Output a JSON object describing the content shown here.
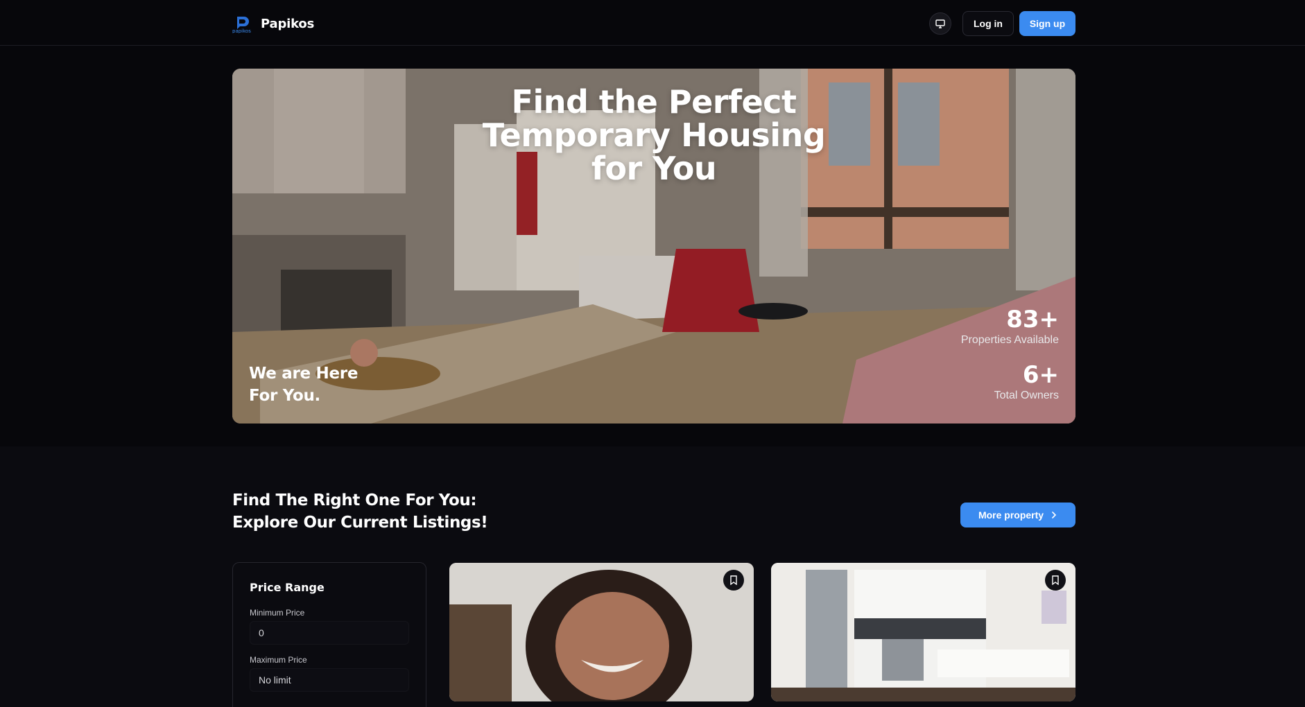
{
  "header": {
    "brand": "Papikos",
    "logo_subtext": "papikos",
    "theme_icon": "monitor-icon",
    "login_label": "Log in",
    "signup_label": "Sign up"
  },
  "hero": {
    "title": "Find the Perfect Temporary Housing for You",
    "tagline": "We are Here For You.",
    "stats": [
      {
        "value": "83+",
        "label": "Properties Available"
      },
      {
        "value": "6+",
        "label": "Total Owners"
      }
    ]
  },
  "listings": {
    "heading_line1": "Find The Right One For You:",
    "heading_line2": "Explore Our Current Listings!",
    "more_label": "More property",
    "more_icon": "chevron-right-icon"
  },
  "filters": {
    "title": "Price Range",
    "min_label": "Minimum Price",
    "min_value": "0",
    "max_label": "Maximum Price",
    "max_placeholder": "No limit"
  },
  "cards": [
    {
      "bookmark_icon": "bookmark-icon"
    },
    {
      "bookmark_icon": "bookmark-icon"
    }
  ],
  "colors": {
    "accent": "#3b8bf0",
    "background": "#0b0b10",
    "header_bg": "#07070b"
  }
}
